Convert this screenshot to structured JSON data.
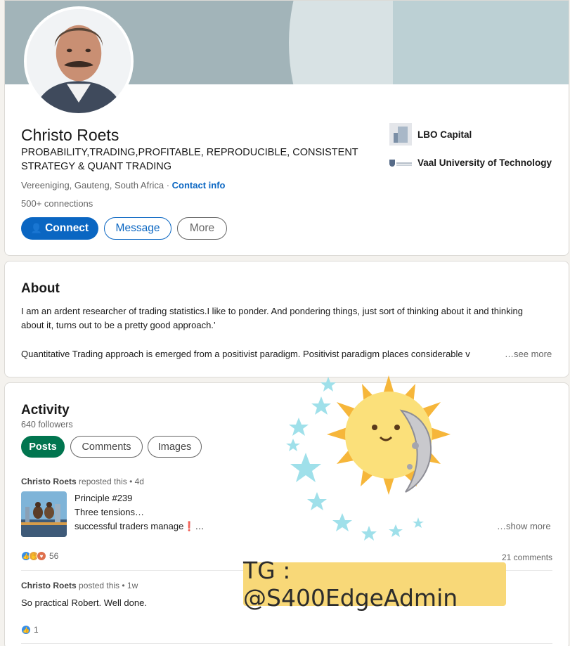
{
  "profile": {
    "name": "Christo Roets",
    "headline": "PROBABILITY,TRADING,PROFITABLE, REPRODUCIBLE, CONSISTENT STRATEGY & QUANT TRADING",
    "location": "Vereeniging, Gauteng, South Africa",
    "location_separator": " · ",
    "contact_info": "Contact info",
    "connections": "500+ connections",
    "buttons": {
      "connect": "Connect",
      "message": "Message",
      "more": "More"
    },
    "experience": [
      {
        "name": "LBO Capital",
        "logo_icon": "company-logo-icon"
      },
      {
        "name": "Vaal University of Technology",
        "logo_icon": "university-logo-icon"
      }
    ]
  },
  "about": {
    "title": "About",
    "paragraph1": "I am an ardent researcher of trading statistics.I like to ponder. And pondering things, just sort of thinking about it and thinking about it, turns out to be a pretty good approach.’",
    "paragraph2": "Quantitative Trading approach is emerged from a positivist paradigm. Positivist paradigm places considerable v",
    "see_more": "…see more"
  },
  "activity": {
    "title": "Activity",
    "followers": "640 followers",
    "tabs": {
      "posts": "Posts",
      "comments": "Comments",
      "images": "Images"
    },
    "posts": [
      {
        "author": "Christo Roets",
        "meta": " reposted this • 4d",
        "lines": [
          "Principle #239",
          "Three tensions…",
          "successful traders manage❗…"
        ],
        "show_more": "…show more",
        "reaction_count": "56",
        "comments": "21 comments"
      },
      {
        "author": "Christo Roets",
        "meta": " posted this • 1w",
        "text": "So practical Robert. Well done.",
        "reaction_count": "1"
      }
    ]
  },
  "overlay": {
    "tg_text": "TG : @S400EdgeAdmin"
  },
  "colors": {
    "primary": "#0a66c2",
    "posts_pill": "#01754f",
    "banner": "#a2b4b9",
    "watermark_banner": "#f8d878"
  }
}
